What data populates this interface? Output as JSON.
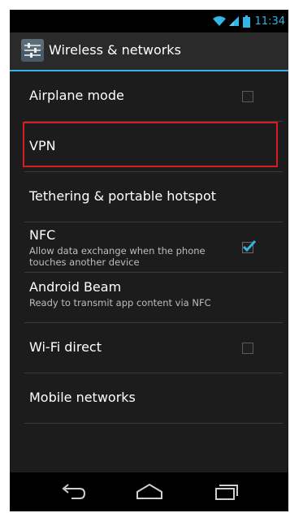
{
  "status_bar": {
    "time": "11:34",
    "icons": [
      "wifi-icon",
      "signal-icon",
      "battery-icon"
    ],
    "accent_color": "#33b5e5"
  },
  "action_bar": {
    "icon": "settings-app-icon",
    "title": "Wireless & networks"
  },
  "settings": [
    {
      "title": "Airplane mode",
      "summary": "",
      "has_checkbox": true,
      "checked": false
    },
    {
      "title": "VPN",
      "summary": "",
      "has_checkbox": false,
      "checked": false
    },
    {
      "title": "Tethering & portable hotspot",
      "summary": "",
      "has_checkbox": false,
      "checked": false
    },
    {
      "title": "NFC",
      "summary": "Allow data exchange when the phone touches another device",
      "has_checkbox": true,
      "checked": true
    },
    {
      "title": "Android Beam",
      "summary": "Ready to transmit app content via NFC",
      "has_checkbox": false,
      "checked": false
    },
    {
      "title": "Wi-Fi direct",
      "summary": "",
      "has_checkbox": true,
      "checked": false
    },
    {
      "title": "Mobile networks",
      "summary": "",
      "has_checkbox": false,
      "checked": false
    }
  ],
  "highlight": {
    "target": "VPN",
    "color": "#d81c24"
  },
  "nav_bar": {
    "buttons": [
      "back-icon",
      "home-icon",
      "recent-apps-icon"
    ]
  }
}
